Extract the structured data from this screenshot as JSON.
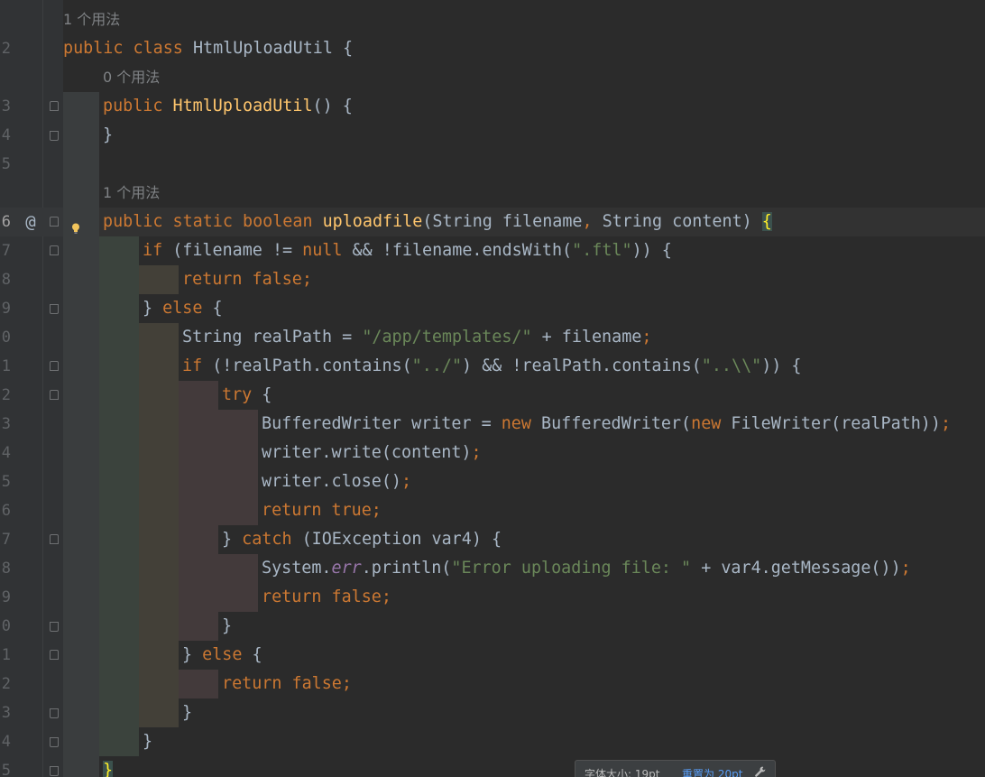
{
  "gutter": {
    "line_numbers": [
      "2",
      "3",
      "4",
      "5",
      "6",
      "7",
      "8",
      "9",
      "0",
      "1",
      "2",
      "3",
      "4",
      "5",
      "6",
      "7",
      "8",
      "9",
      "0",
      "1",
      "2",
      "3",
      "4",
      "5"
    ]
  },
  "hints": {
    "usage_1": "1 个用法",
    "usage_0": "0 个用法",
    "usage_method": "1 个用法"
  },
  "code": {
    "l2_kw": "public class ",
    "l2_name": "HtmlUploadUtil ",
    "l2_brace": "{",
    "l3_kw": "public ",
    "l3_name": "HtmlUploadUtil",
    "l3_rest": "() {",
    "l4": "}",
    "l6_kw": "public static boolean ",
    "l6_fn": "uploadfile",
    "l6_p1": "(String filename",
    "l6_comma": ", ",
    "l6_p2": "String content) ",
    "l6_brace": "{",
    "l7_if": "if ",
    "l7_a": "(filename != ",
    "l7_null": "null ",
    "l7_b": "&& !filename.endsWith(",
    "l7_str": "\".ftl\"",
    "l7_c": ")) {",
    "l8_kw": "return false",
    "l8_semi": ";",
    "l9_a": "} ",
    "l9_else": "else ",
    "l9_b": "{",
    "l10_a": "String realPath = ",
    "l10_str": "\"/app/templates/\" ",
    "l10_b": "+ filename",
    "l10_semi": ";",
    "l11_if": "if ",
    "l11_a": "(!realPath.contains(",
    "l11_s1": "\"../\"",
    "l11_b": ") && !realPath.contains(",
    "l11_s2": "\"..\\\\\"",
    "l11_c": ")) {",
    "l12_try": "try ",
    "l12_b": "{",
    "l13_a": "BufferedWriter writer = ",
    "l13_new": "new ",
    "l13_b": "BufferedWriter(",
    "l13_new2": "new ",
    "l13_c": "FileWriter(realPath))",
    "l13_semi": ";",
    "l14_a": "writer.write(content)",
    "l14_semi": ";",
    "l15_a": "writer.close()",
    "l15_semi": ";",
    "l16_kw": "return true",
    "l16_semi": ";",
    "l17_a": "} ",
    "l17_catch": "catch ",
    "l17_b": "(IOException var4) {",
    "l18_a": "System.",
    "l18_err": "err",
    "l18_b": ".println(",
    "l18_str": "\"Error uploading file: \" ",
    "l18_c": "+ var4.getMessage())",
    "l18_semi": ";",
    "l19_kw": "return false",
    "l19_semi": ";",
    "l20": "}",
    "l21_a": "} ",
    "l21_else": "else ",
    "l21_b": "{",
    "l22_kw": "return false",
    "l22_semi": ";",
    "l23": "}",
    "l24": "}",
    "l25": "}"
  },
  "markers": {
    "override": "@"
  },
  "tooltip": {
    "font_size": "字体大小: 19pt",
    "reset": "重置为 20pt"
  },
  "colors": {
    "background": "#2b2b2b",
    "keyword": "#cc7832",
    "string": "#6a8759",
    "function": "#ffc66d",
    "text": "#a9b7c6",
    "static_field": "#9876aa",
    "link": "#589df6"
  }
}
